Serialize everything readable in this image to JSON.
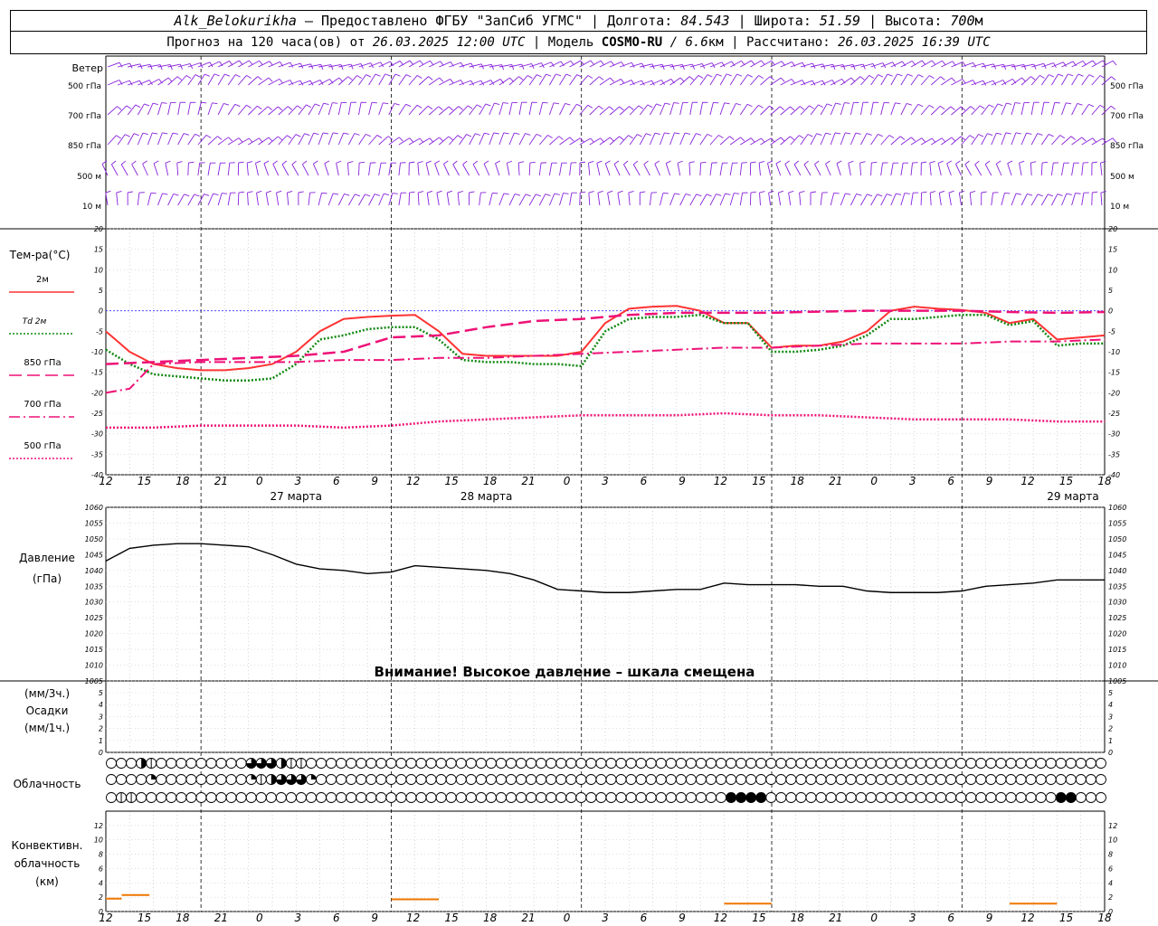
{
  "header": {
    "station": "Alk_Belokurikha",
    "provider": " – Предоставлено ФГБУ \"ЗапСиб УГМС\" | Долгота: ",
    "lon": "84.543",
    "lat_label": " | Широта: ",
    "lat": "51.59",
    "alt_label": " | Высота: ",
    "alt": "700",
    "alt_unit": "м",
    "line2_a": "Прогноз на 120 часа(ов) от ",
    "issued": "26.03.2025 12:00 UTC",
    "line2_b": " | Модель ",
    "model": "COSMO-RU",
    "res": " / 6.6",
    "res_unit": "км",
    "line2_c": " | Рассчитано: ",
    "computed": "26.03.2025 16:39 UTC"
  },
  "wind_panel": {
    "title": "Ветер",
    "levels": [
      "500 гПа",
      "700 гПа",
      "850 гПа",
      "500 м",
      "10 м"
    ]
  },
  "temp_panel": {
    "title": "Тем-ра(°C)",
    "legend": [
      {
        "label": "2м",
        "color": "#ff3333",
        "style": "solid"
      },
      {
        "label": "Td 2м",
        "color": "#118811",
        "style": "dotted"
      },
      {
        "label": "850 гПа",
        "color": "#ee1177",
        "style": "dash"
      },
      {
        "label": "700 гПа",
        "color": "#ee1177",
        "style": "dashdot"
      },
      {
        "label": "500 гПа",
        "color": "#ee1177",
        "style": "dot"
      }
    ]
  },
  "pressure_panel": {
    "title": "Давление",
    "unit": "(гПа)",
    "warning": "Внимание! Высокое давление – шкала смещена"
  },
  "precip_panel": {
    "unit3": "(мм/3ч.)",
    "title": "Осадки",
    "unit1": "(мм/1ч.)"
  },
  "cloud_panel": {
    "title": "Облачность"
  },
  "conv_panel": {
    "title1": "Конвективн.",
    "title2": "облачность",
    "unit": "(км)"
  },
  "x_axis": {
    "hour_labels": [
      "12",
      "15",
      "18",
      "21",
      "0",
      "3",
      "6",
      "9",
      "12",
      "15",
      "18",
      "21",
      "0",
      "3",
      "6",
      "9",
      "12",
      "15",
      "18",
      "21",
      "0",
      "3",
      "6",
      "9",
      "12",
      "15",
      "18"
    ],
    "dates": [
      "27 марта",
      "28 марта",
      "29 марта"
    ]
  },
  "chart_data": [
    {
      "type": "line",
      "title": "Тем-ра(°C)",
      "x_unit": "hours since 26.03.2025 12:00 UTC",
      "ylim": [
        -40,
        20
      ],
      "yticks": [
        -40,
        -35,
        -30,
        -25,
        -20,
        -15,
        -10,
        -5,
        0,
        5,
        10,
        15,
        20
      ],
      "series": [
        {
          "name": "2м",
          "x": [
            0,
            3,
            6,
            9,
            12,
            15,
            18,
            21,
            24,
            27,
            30,
            33,
            36,
            39,
            42,
            45,
            48,
            51,
            54,
            57,
            60,
            63,
            66,
            69,
            72,
            75,
            78,
            81,
            84,
            87,
            90,
            93,
            96,
            99,
            102,
            105,
            108,
            111,
            114,
            117,
            120,
            123,
            126
          ],
          "values": [
            -5,
            -10,
            -13,
            -14,
            -14.5,
            -14.5,
            -14,
            -13,
            -10,
            -5,
            -2,
            -1.5,
            -1.2,
            -1,
            -5,
            -10.5,
            -11,
            -11,
            -11,
            -11,
            -10,
            -3,
            0.5,
            1,
            1.2,
            0,
            -3,
            -3,
            -9,
            -8.5,
            -8.5,
            -7.5,
            -5,
            0,
            1,
            0.5,
            0.2,
            -0.5,
            -3,
            -2,
            -7,
            -6.5,
            -6
          ]
        },
        {
          "name": "Td 2м",
          "x": [
            0,
            3,
            6,
            9,
            12,
            15,
            18,
            21,
            24,
            27,
            30,
            33,
            36,
            39,
            42,
            45,
            48,
            51,
            54,
            57,
            60,
            63,
            66,
            69,
            72,
            75,
            78,
            81,
            84,
            87,
            90,
            93,
            96,
            99,
            102,
            105,
            108,
            111,
            114,
            117,
            120,
            123,
            126
          ],
          "values": [
            -9.5,
            -13,
            -15.5,
            -16,
            -16.5,
            -17,
            -17,
            -16.5,
            -13,
            -7,
            -6,
            -4.5,
            -4,
            -4,
            -7,
            -12,
            -12.5,
            -12.5,
            -13,
            -13,
            -13.5,
            -5,
            -2,
            -1.5,
            -1.5,
            -1,
            -3,
            -3,
            -10,
            -10,
            -9.5,
            -8.5,
            -6,
            -2,
            -2,
            -1.5,
            -1,
            -1,
            -3.5,
            -2.5,
            -8.5,
            -8,
            -8
          ]
        },
        {
          "name": "850 гПа",
          "x": [
            0,
            6,
            12,
            18,
            24,
            30,
            36,
            42,
            48,
            54,
            60,
            66,
            72,
            78,
            84,
            90,
            96,
            102,
            108,
            114,
            120,
            126
          ],
          "values": [
            -13,
            -12.5,
            -12,
            -11.5,
            -11,
            -10,
            -6.5,
            -6,
            -4,
            -2.5,
            -2,
            -1,
            -0.5,
            -0.5,
            -0.5,
            -0.2,
            0,
            0,
            0,
            -0.3,
            -0.5,
            -0.3
          ]
        },
        {
          "name": "700 гПа",
          "x": [
            0,
            3,
            6,
            12,
            18,
            24,
            30,
            36,
            42,
            48,
            54,
            60,
            66,
            72,
            78,
            84,
            90,
            96,
            102,
            108,
            114,
            120,
            126
          ],
          "values": [
            -20,
            -19,
            -13,
            -12.5,
            -12.5,
            -12.5,
            -12,
            -12,
            -11.5,
            -11.5,
            -11,
            -10.5,
            -10,
            -9.5,
            -9,
            -9,
            -8.5,
            -8,
            -8,
            -8,
            -7.5,
            -7.5,
            -7
          ]
        },
        {
          "name": "500 гПа",
          "x": [
            0,
            6,
            12,
            18,
            24,
            30,
            36,
            42,
            48,
            54,
            60,
            66,
            72,
            78,
            84,
            90,
            96,
            102,
            108,
            114,
            120,
            126
          ],
          "values": [
            -28.5,
            -28.5,
            -28,
            -28,
            -28,
            -28.5,
            -28,
            -27,
            -26.5,
            -26,
            -25.5,
            -25.5,
            -25.5,
            -25,
            -25.5,
            -25.5,
            -26,
            -26.5,
            -26.5,
            -26.5,
            -27,
            -27
          ]
        }
      ]
    },
    {
      "type": "line",
      "title": "Давление",
      "x_unit": "hours since 26.03.2025 12:00 UTC",
      "ylim": [
        1005,
        1060
      ],
      "yticks": [
        1005,
        1010,
        1015,
        1020,
        1025,
        1030,
        1035,
        1040,
        1045,
        1050,
        1055,
        1060
      ],
      "series": [
        {
          "name": "Давление",
          "x": [
            0,
            3,
            6,
            9,
            12,
            15,
            18,
            21,
            24,
            27,
            30,
            33,
            36,
            39,
            42,
            45,
            48,
            51,
            54,
            57,
            60,
            63,
            66,
            69,
            72,
            75,
            78,
            81,
            84,
            87,
            90,
            93,
            96,
            99,
            102,
            105,
            108,
            111,
            114,
            117,
            120,
            123,
            126
          ],
          "values": [
            1043,
            1047,
            1048,
            1048.5,
            1048.5,
            1048,
            1047.5,
            1045,
            1042,
            1040.5,
            1040,
            1039,
            1039.5,
            1041.5,
            1041,
            1040.5,
            1040,
            1039,
            1037,
            1034,
            1033.5,
            1033,
            1033,
            1033.5,
            1034,
            1034,
            1036,
            1035.5,
            1035.5,
            1035.5,
            1035,
            1035,
            1033.5,
            1033,
            1033,
            1033,
            1033.5,
            1035,
            1035.5,
            1036,
            1037,
            1037,
            1037
          ]
        }
      ]
    },
    {
      "type": "bar",
      "title": "Осадки",
      "ylim": [
        0,
        5
      ],
      "yticks": [
        0,
        1,
        2,
        3,
        4,
        5
      ],
      "values": []
    },
    {
      "type": "bar",
      "title": "Конвективн. облачность",
      "ylim": [
        0,
        14
      ],
      "yticks": [
        0,
        2,
        4,
        6,
        8,
        10,
        12
      ],
      "segments": [
        {
          "x": [
            0,
            2
          ],
          "value": 1.8
        },
        {
          "x": [
            2,
            5.5
          ],
          "value": 2.3
        },
        {
          "x": [
            36,
            42
          ],
          "value": 1.7
        },
        {
          "x": [
            78,
            84
          ],
          "value": 1.1
        },
        {
          "x": [
            114,
            120
          ],
          "value": 1.1
        }
      ]
    }
  ],
  "clouds": {
    "rows": [
      "00031000000000444311000000000000000000000000000000000000000000000000000000000000000000000000000000000000000000000000000000000002",
      "00002000000000213444200000000000000000000000000000000000000000000000000000000000000000000000000000000000000000000000000000000111",
      "01100000000000000000000000000000000000000000000000000000000000000000000000000000000000000000000000000000000000000000000000000000"
    ]
  },
  "colors": {
    "wind": "#8822dd",
    "grid": "#000000",
    "t2m": "#ff3333",
    "td": "#118811",
    "upper": "#ee1177",
    "conv": "#ee7700",
    "zero": "#3333ff"
  }
}
